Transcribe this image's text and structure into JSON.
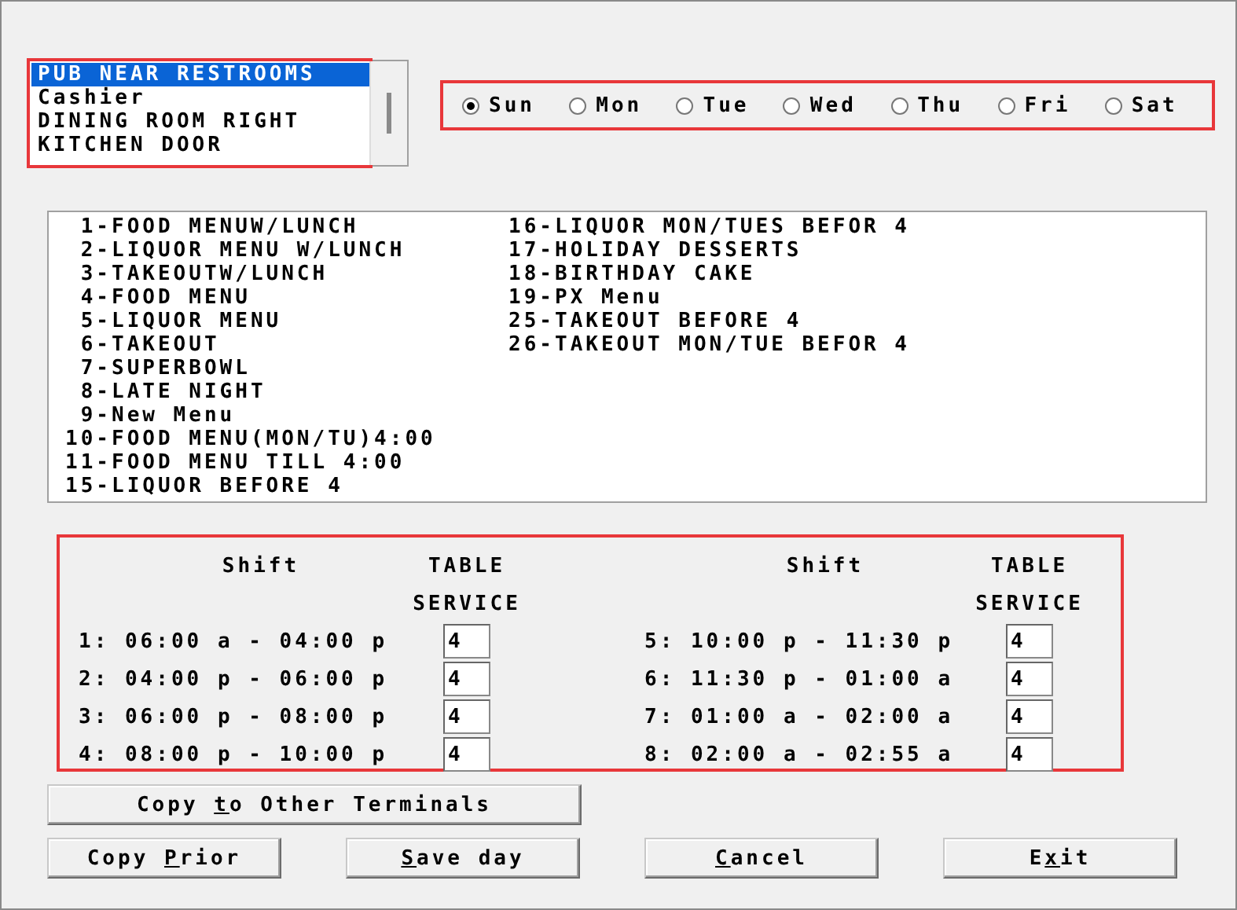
{
  "terminals": {
    "highlighted": true,
    "items": [
      {
        "label": "PUB NEAR RESTROOMS",
        "selected": true
      },
      {
        "label": "Cashier",
        "selected": false
      },
      {
        "label": "DINING ROOM RIGHT",
        "selected": false
      },
      {
        "label": "KITCHEN DOOR",
        "selected": false
      }
    ]
  },
  "days": {
    "highlighted": true,
    "items": [
      {
        "label": "Sun",
        "selected": true
      },
      {
        "label": "Mon",
        "selected": false
      },
      {
        "label": "Tue",
        "selected": false
      },
      {
        "label": "Wed",
        "selected": false
      },
      {
        "label": "Thu",
        "selected": false
      },
      {
        "label": "Fri",
        "selected": false
      },
      {
        "label": "Sat",
        "selected": false
      }
    ]
  },
  "menus": {
    "items": [
      {
        "number": "1-",
        "name": "FOOD MENUW/LUNCH"
      },
      {
        "number": "2-",
        "name": "LIQUOR MENU W/LUNCH"
      },
      {
        "number": "3-",
        "name": "TAKEOUTW/LUNCH"
      },
      {
        "number": "4-",
        "name": "FOOD MENU"
      },
      {
        "number": "5-",
        "name": "LIQUOR MENU"
      },
      {
        "number": "6-",
        "name": "TAKEOUT"
      },
      {
        "number": "7-",
        "name": "SUPERBOWL"
      },
      {
        "number": "8-",
        "name": "LATE NIGHT"
      },
      {
        "number": "9-",
        "name": "New Menu"
      },
      {
        "number": "10-",
        "name": "FOOD MENU(MON/TU)4:00"
      },
      {
        "number": "11-",
        "name": "FOOD MENU TILL 4:00"
      },
      {
        "number": "15-",
        "name": "LIQUOR BEFORE 4"
      },
      {
        "number": "16-",
        "name": "LIQUOR MON/TUES BEFOR 4"
      },
      {
        "number": "17-",
        "name": "HOLIDAY DESSERTS"
      },
      {
        "number": "18-",
        "name": "BIRTHDAY CAKE"
      },
      {
        "number": "19-",
        "name": "PX Menu"
      },
      {
        "number": "25-",
        "name": "TAKEOUT BEFORE 4"
      },
      {
        "number": "26-",
        "name": "TAKEOUT MON/TUE BEFOR 4"
      }
    ]
  },
  "shift_panel": {
    "highlighted": true,
    "headers": [
      {
        "shift": "Shift",
        "service_line_1": "TABLE",
        "service_line_2": "SERVICE"
      },
      {
        "shift": "Shift",
        "service_line_1": "TABLE",
        "service_line_2": "SERVICE"
      }
    ],
    "shifts": [
      {
        "range": "1: 06:00 a - 04:00 p",
        "table_service": "4"
      },
      {
        "range": "2: 04:00 p - 06:00 p",
        "table_service": "4"
      },
      {
        "range": "3: 06:00 p - 08:00 p",
        "table_service": "4"
      },
      {
        "range": "4: 08:00 p - 10:00 p",
        "table_service": "4"
      },
      {
        "range": "5: 10:00 p - 11:30 p",
        "table_service": "4"
      },
      {
        "range": "6: 11:30 p - 01:00 a",
        "table_service": "4"
      },
      {
        "range": "7: 01:00 a - 02:00 a",
        "table_service": "4"
      },
      {
        "range": "8: 02:00 a - 02:55 a",
        "table_service": "4"
      }
    ]
  },
  "copy_button": {
    "before": "Copy ",
    "key": "t",
    "after": "o Other Terminals"
  },
  "buttons": [
    {
      "before": "Copy ",
      "key": "P",
      "after": "rior"
    },
    {
      "key": "S",
      "after": "ave day"
    },
    {
      "key": "C",
      "after": "ancel"
    },
    {
      "before": "E",
      "key": "x",
      "after": "it"
    }
  ]
}
